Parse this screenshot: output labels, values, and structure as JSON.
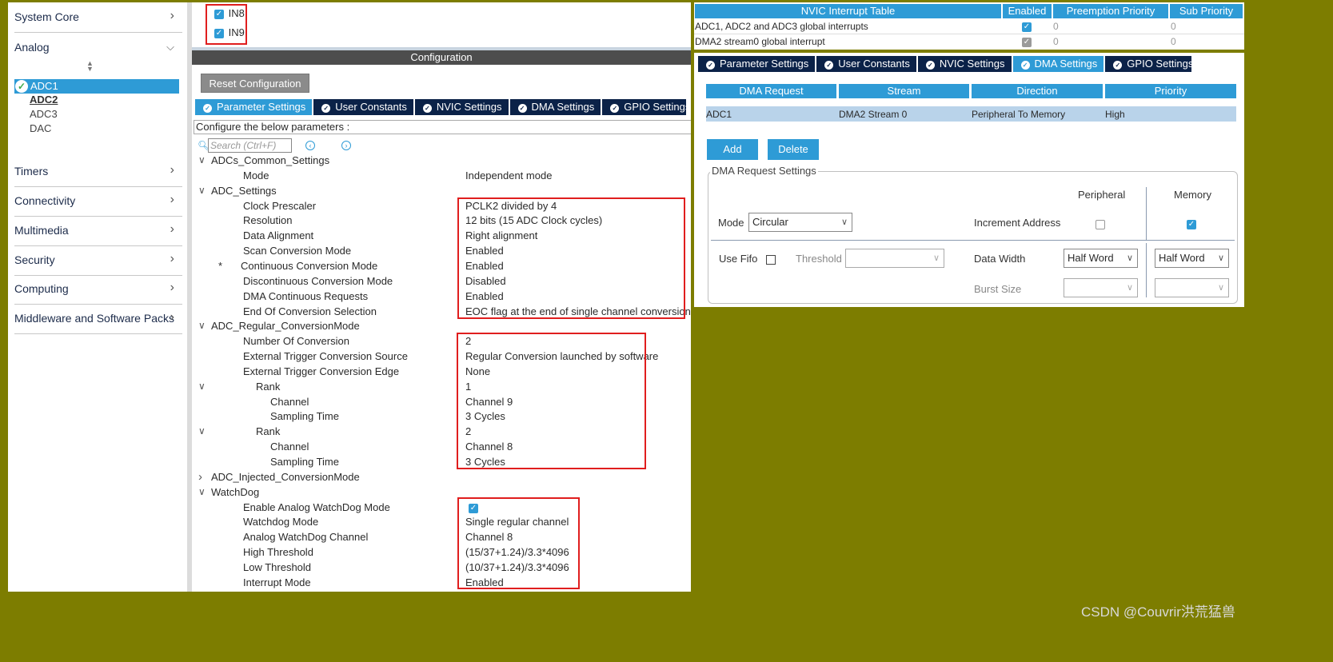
{
  "sidebar": {
    "categories": [
      "System Core",
      "Analog",
      "Timers",
      "Connectivity",
      "Multimedia",
      "Security",
      "Computing",
      "Middleware and Software Packs"
    ],
    "sort_icon": "sort-arrows-icon",
    "items": [
      {
        "label": "ADC1",
        "selected": true,
        "status_icon": "check-circle-icon"
      },
      {
        "label": "ADC2",
        "bold_underlined": true
      },
      {
        "label": "ADC3"
      },
      {
        "label": "DAC"
      }
    ]
  },
  "channels": [
    {
      "label": "IN8",
      "checked": true
    },
    {
      "label": "IN9",
      "checked": true
    }
  ],
  "config": {
    "title": "Configuration",
    "reset_button": "Reset Configuration",
    "tabs": [
      "Parameter Settings",
      "User Constants",
      "NVIC Settings",
      "DMA Settings",
      "GPIO Settings"
    ],
    "active_tab": "Parameter Settings",
    "params_header": "Configure the below parameters :",
    "search_placeholder": "Search (Ctrl+F)",
    "rows": [
      {
        "name": "ADCs_Common_Settings",
        "value": "",
        "group": true,
        "expander": "v"
      },
      {
        "name": "Mode",
        "value": "Independent mode"
      },
      {
        "name": "ADC_Settings",
        "value": "",
        "group": true,
        "expander": "v"
      },
      {
        "name": "Clock Prescaler",
        "value": "PCLK2 divided by 4"
      },
      {
        "name": "Resolution",
        "value": "12 bits (15 ADC Clock cycles)"
      },
      {
        "name": "Data Alignment",
        "value": "Right alignment"
      },
      {
        "name": "Scan Conversion Mode",
        "value": "Enabled"
      },
      {
        "name": "Continuous Conversion Mode",
        "value": "Enabled",
        "star": "*"
      },
      {
        "name": "Discontinuous Conversion Mode",
        "value": "Disabled"
      },
      {
        "name": "DMA Continuous Requests",
        "value": "Enabled"
      },
      {
        "name": "End Of Conversion Selection",
        "value": "EOC flag at the end of single channel conversion"
      },
      {
        "name": "ADC_Regular_ConversionMode",
        "value": "",
        "group": true,
        "expander": "v"
      },
      {
        "name": "Number Of Conversion",
        "value": "2"
      },
      {
        "name": "External Trigger Conversion Source",
        "value": "Regular Conversion launched by software"
      },
      {
        "name": "External Trigger Conversion Edge",
        "value": "None"
      },
      {
        "name": "Rank",
        "value": "1",
        "level": 2,
        "expander": "v"
      },
      {
        "name": "Channel",
        "value": "Channel 9",
        "level": 3
      },
      {
        "name": "Sampling Time",
        "value": "3 Cycles",
        "level": 3
      },
      {
        "name": "Rank",
        "value": "2",
        "level": 2,
        "expander": "v"
      },
      {
        "name": "Channel",
        "value": "Channel 8",
        "level": 3
      },
      {
        "name": "Sampling Time",
        "value": "3 Cycles",
        "level": 3
      },
      {
        "name": "ADC_Injected_ConversionMode",
        "value": "",
        "group": true,
        "expander": ">"
      },
      {
        "name": "WatchDog",
        "value": "",
        "group": true,
        "expander": "v"
      },
      {
        "name": "Enable Analog WatchDog Mode",
        "value": "",
        "checkbox": true
      },
      {
        "name": "Watchdog Mode",
        "value": "Single regular channel"
      },
      {
        "name": "Analog WatchDog Channel",
        "value": "Channel 8"
      },
      {
        "name": "High Threshold",
        "value": "(15/37+1.24)/3.3*4096"
      },
      {
        "name": "Low Threshold",
        "value": "(10/37+1.24)/3.3*4096"
      },
      {
        "name": "Interrupt Mode",
        "value": "Enabled"
      }
    ]
  },
  "nvic": {
    "headers": [
      "NVIC Interrupt Table",
      "Enabled",
      "Preemption Priority",
      "Sub Priority"
    ],
    "rows": [
      {
        "name": "ADC1, ADC2 and ADC3 global interrupts",
        "enabled": true,
        "preemption": "0",
        "sub": "0"
      },
      {
        "name": "DMA2 stream0 global interrupt",
        "enabled": true,
        "preemption": "0",
        "sub": "0"
      }
    ]
  },
  "dma": {
    "tabs": [
      "Parameter Settings",
      "User Constants",
      "NVIC Settings",
      "DMA Settings",
      "GPIO Settings"
    ],
    "active_tab": "DMA Settings",
    "headers": [
      "DMA Request",
      "Stream",
      "Direction",
      "Priority"
    ],
    "rows": [
      {
        "request": "ADC1",
        "stream": "DMA2 Stream 0",
        "direction": "Peripheral To Memory",
        "priority": "High"
      }
    ],
    "add_button": "Add",
    "delete_button": "Delete",
    "settings_legend": "DMA Request Settings",
    "peripheral_label": "Peripheral",
    "memory_label": "Memory",
    "mode_label": "Mode",
    "mode_value": "Circular",
    "increment_label": "Increment Address",
    "use_fifo_label": "Use Fifo",
    "threshold_label": "Threshold",
    "data_width_label": "Data Width",
    "data_width_periph": "Half Word",
    "data_width_mem": "Half Word",
    "burst_size_label": "Burst Size"
  },
  "watermark": "CSDN @Couvrir洪荒猛兽"
}
